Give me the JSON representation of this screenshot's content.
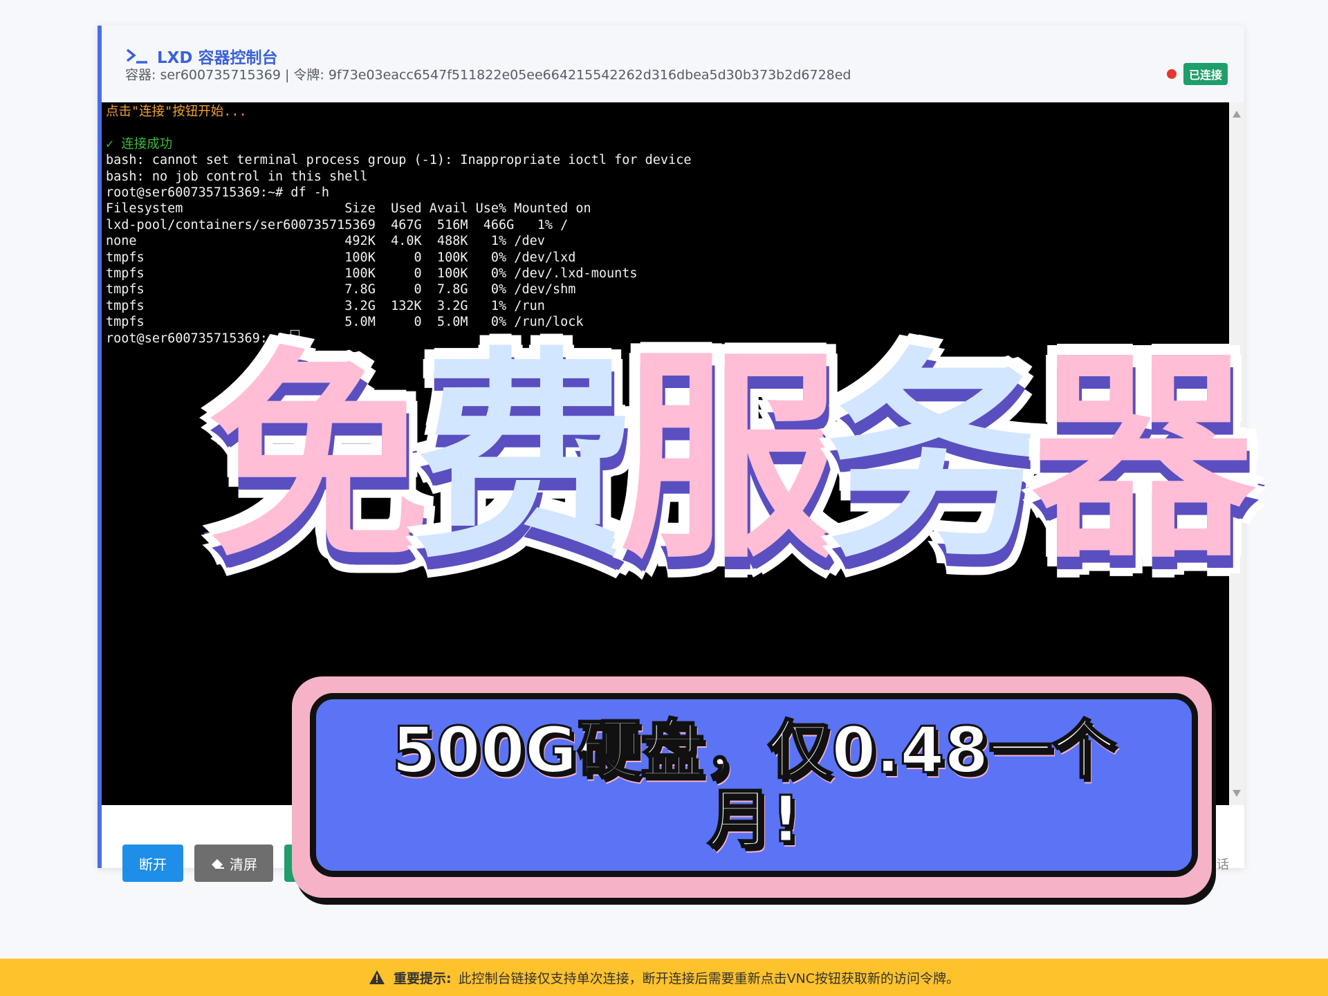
{
  "header": {
    "title": "LXD 容器控制台",
    "meta": "容器: ser600735715369 | 令牌: 9f73e03eacc6547f511822e05ee664215542262d316dbea5d30b373b2d6728ed",
    "status_badge": "已连接"
  },
  "terminal": {
    "lines": [
      {
        "text": "点击\"连接\"按钮开始...",
        "color": "#f0a030"
      },
      {
        "text": "",
        "color": "#f2f2f2"
      },
      {
        "text": "✓ 连接成功",
        "color": "#3db83d"
      },
      {
        "text": "bash: cannot set terminal process group (-1): Inappropriate ioctl for device",
        "color": "#f2f2f2"
      },
      {
        "text": "bash: no job control in this shell",
        "color": "#f2f2f2"
      },
      {
        "text": "root@ser600735715369:~# df -h",
        "color": "#f2f2f2"
      },
      {
        "text": "Filesystem                     Size  Used Avail Use% Mounted on",
        "color": "#f2f2f2"
      },
      {
        "text": "lxd-pool/containers/ser600735715369  467G  516M  466G   1% /",
        "color": "#f2f2f2"
      },
      {
        "text": "none                           492K  4.0K  488K   1% /dev",
        "color": "#f2f2f2"
      },
      {
        "text": "tmpfs                          100K     0  100K   0% /dev/lxd",
        "color": "#f2f2f2"
      },
      {
        "text": "tmpfs                          100K     0  100K   0% /dev/.lxd-mounts",
        "color": "#f2f2f2"
      },
      {
        "text": "tmpfs                          7.8G     0  7.8G   0% /dev/shm",
        "color": "#f2f2f2"
      },
      {
        "text": "tmpfs                          3.2G  132K  3.2G   1% /run",
        "color": "#f2f2f2"
      },
      {
        "text": "tmpfs                          5.0M     0  5.0M   0% /run/lock",
        "color": "#f2f2f2"
      },
      {
        "text": "root@ser600735715369:~# ",
        "color": "#f2f2f2",
        "cursor": true
      }
    ]
  },
  "toolbar": {
    "disconnect_label": "断开",
    "clear_label": "清屏",
    "hint": "话"
  },
  "overlay": {
    "big_title_chars": [
      {
        "char": "免",
        "tone": "pink"
      },
      {
        "char": "费",
        "tone": "blue"
      },
      {
        "char": "服",
        "tone": "pink"
      },
      {
        "char": "务",
        "tone": "blue"
      },
      {
        "char": "器",
        "tone": "pink"
      }
    ],
    "banner_text": "500G硬盘，仅0.48一个月!"
  },
  "notice": {
    "label": "重要提示:",
    "text": "此控制台链接仅支持单次连接，断开连接后需要重新点击VNC按钮获取新的访问令牌。"
  },
  "colors": {
    "accent": "#4a6fe3",
    "status_dot": "#e5392f",
    "status_badge": "#1e9e6a",
    "notice_bg": "#fdc22c",
    "banner_bg": "#5b73f5"
  }
}
